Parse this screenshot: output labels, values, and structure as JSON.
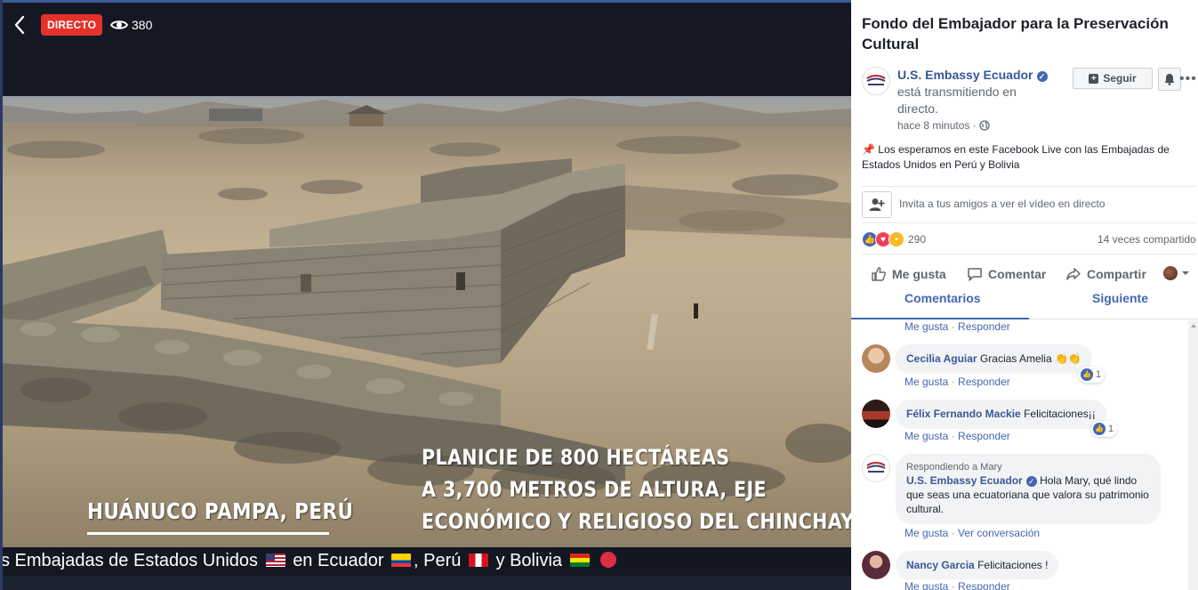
{
  "video": {
    "live_label": "DIRECTO",
    "viewer_count": "380",
    "location_caption": "HUÁNUCO PAMPA, PERÚ",
    "info_caption_lines": [
      "PLANICIE DE 800 HECTÁREAS",
      "A 3,700 METROS DE ALTURA,  EJE",
      "ECONÓMICO Y RELIGIOSO DEL CHINCHAYSUYO."
    ],
    "ticker": {
      "part1": "s Embajadas de Estados Unidos",
      "part2": "en Ecuador",
      "part3": ", Perú",
      "part4": "y Bolivia"
    }
  },
  "post": {
    "title": "Fondo del Embajador para la Preservación Cultural",
    "page_name": "U.S. Embassy Ecuador",
    "status": "está transmitiendo en directo.",
    "time": "hace 8 minutos · ",
    "follow_label": "Seguir",
    "text": "Los esperamos en este Facebook Live con las Embajadas de Estados Unidos en Perú y Bolivia",
    "invite_text": "Invita a tus amigos a ver el vídeo en directo",
    "reaction_count": "290",
    "shares": "14 veces compartido",
    "actions": {
      "like": "Me gusta",
      "comment": "Comentar",
      "share": "Compartir"
    },
    "tabs": {
      "comments": "Comentarios",
      "following": "Siguiente"
    }
  },
  "comments": {
    "meta_like": "Me gusta",
    "meta_reply": "Responder",
    "meta_dot": "·",
    "items": [
      {
        "name": "Cecilia Aguiar",
        "text": "Gracias Amelia",
        "likes": "1"
      },
      {
        "name": "Félix Fernando Mackie",
        "text": "Felicitaciones¡¡",
        "likes": "1"
      },
      {
        "replying_to": "Respondiendo a Mary",
        "name": "U.S. Embassy Ecuador",
        "text": "Hola Mary, qué lindo que seas una ecuatoriana que valora su patrimonio cultural.",
        "extra": "Ver conversación"
      },
      {
        "name": "Nancy Garcia",
        "text": "Felicitaciones !"
      }
    ]
  },
  "colors": {
    "live_red": "#e4322b",
    "facebook_blue": "#4267b2",
    "link_blue": "#385898"
  }
}
